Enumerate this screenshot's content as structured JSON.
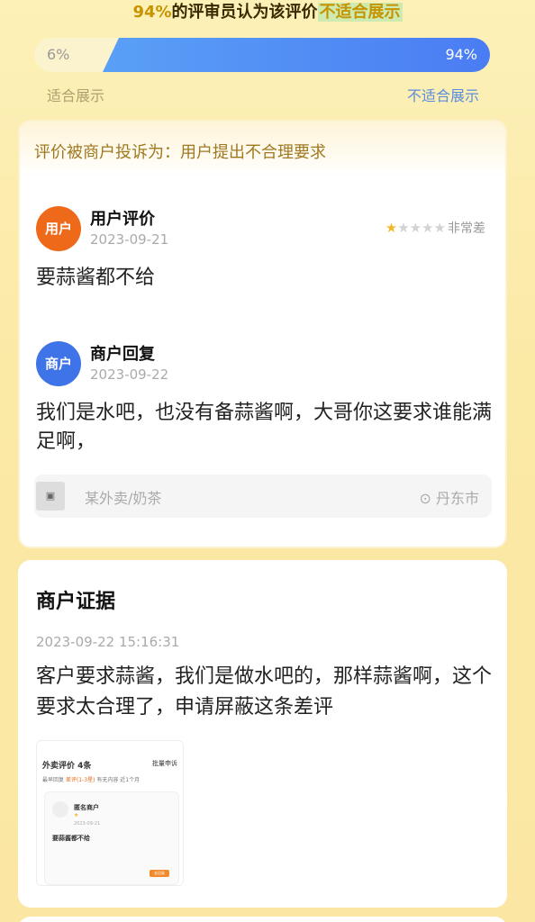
{
  "headline": {
    "percent": "94%",
    "middle": "的评审员认为该评价",
    "highlight": "不适合展示"
  },
  "vote": {
    "suitable_pct": "6%",
    "unsuitable_pct": "94%",
    "suitable_label": "适合展示",
    "unsuitable_label": "不适合展示",
    "bar_color": "#4a7cf3"
  },
  "review_card": {
    "complaint": "评价被商户投诉为：用户提出不合理要求",
    "user": {
      "avatar_text": "用户",
      "name": "用户评价",
      "date": "2023-09-21",
      "rating": 1,
      "rating_max": 5,
      "rating_text": "非常差",
      "text": "要蒜酱都不给"
    },
    "merchant": {
      "avatar_text": "商户",
      "name": "商户回复",
      "date": "2023-09-22",
      "text": "我们是水吧，也没有备蒜酱啊，大哥你这要求谁能满足啊，"
    },
    "shop": {
      "name": "某外卖/奶茶",
      "city": "丹东市",
      "icon": "location-pin-icon"
    }
  },
  "evidence_card": {
    "title": "商户证据",
    "date": "2023-09-22 15:16:31",
    "text": "客户要求蒜酱，我们是做水吧的，那样蒜酱啊，这个要求太合理了，申请屏蔽这条差评",
    "screenshot": {
      "title": "外卖评价 4条",
      "action": "批量申诉",
      "filters": [
        "最早回复",
        "差评(1-3星)",
        "有无内容",
        "近1个月"
      ],
      "reviewer": "匿名商户",
      "review_text": "要蒜酱都不给",
      "button": "去回复"
    }
  }
}
